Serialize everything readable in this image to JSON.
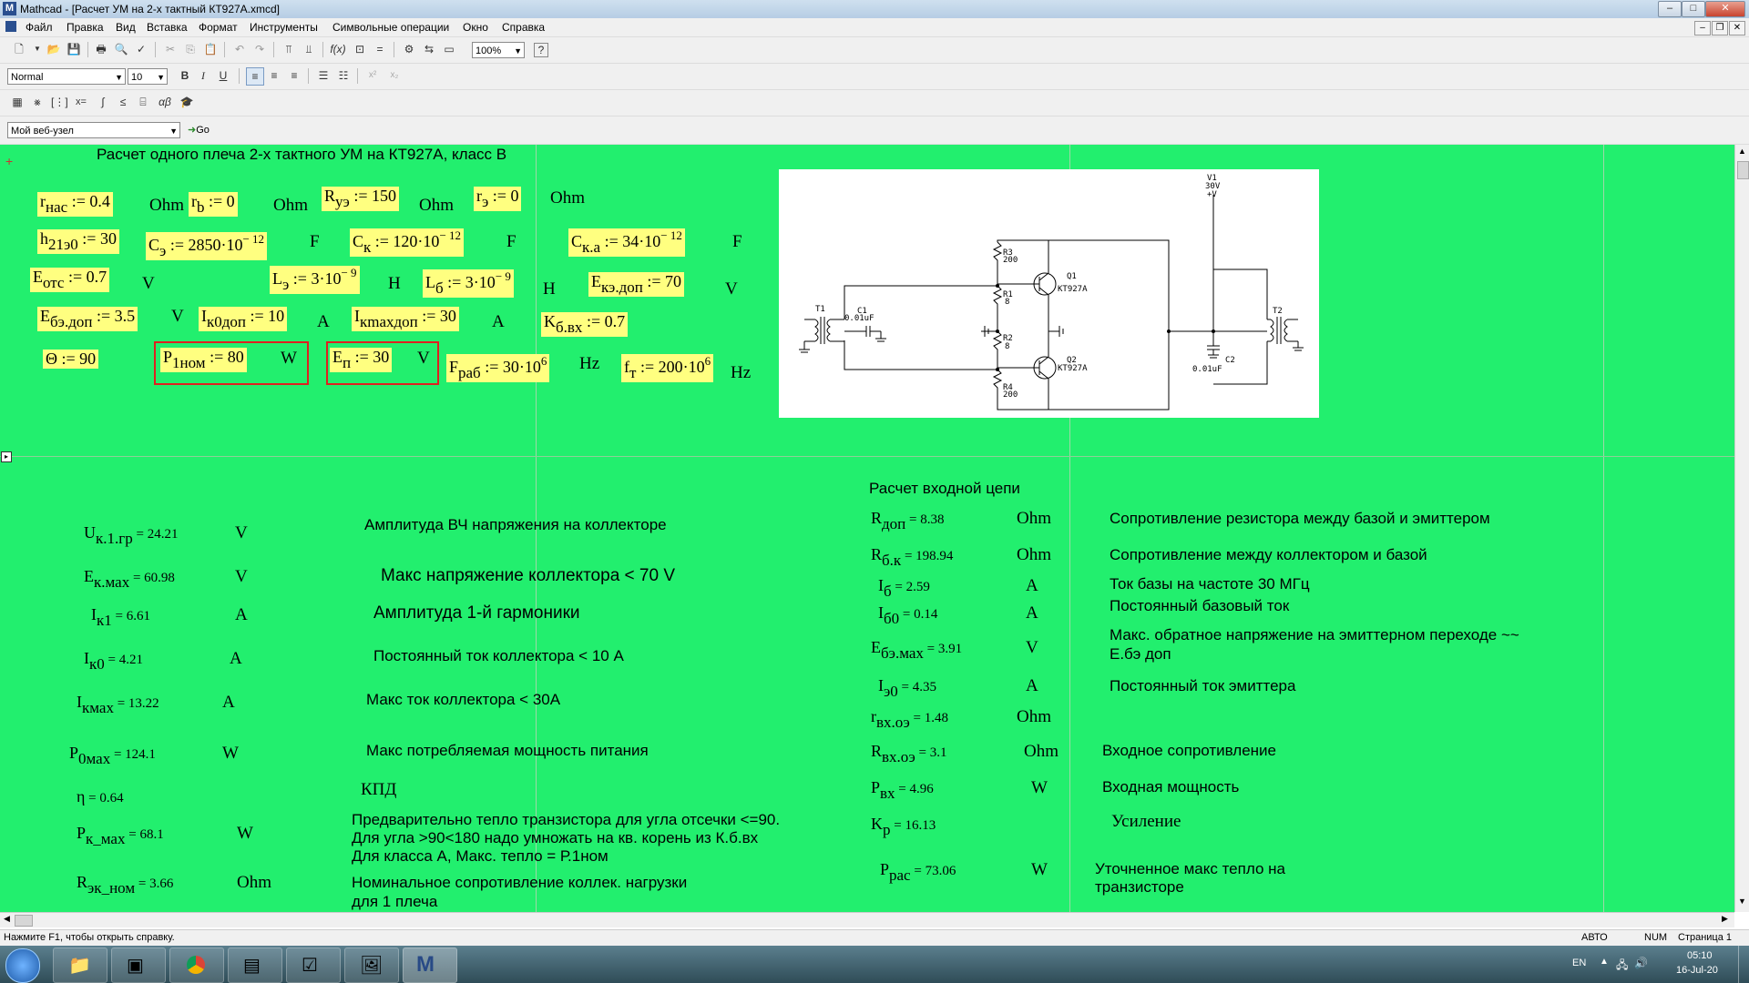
{
  "window": {
    "title": "Mathcad - [Расчет УМ на 2-х тактный КТ927А.xmcd]",
    "app_icon": "M"
  },
  "menu": [
    "Файл",
    "Правка",
    "Вид",
    "Вставка",
    "Формат",
    "Инструменты",
    "Символьные операции",
    "Окно",
    "Справка"
  ],
  "toolbar": {
    "zoom": "100%",
    "style": "Normal",
    "font_size": "10",
    "bold": "B",
    "italic": "I",
    "underline": "U",
    "web_node": "Мой веб-узел",
    "go": "Go"
  },
  "doc": {
    "heading": "Расчет одного плеча 2-х тактного УМ на КТ927А, класс В",
    "params_units": {
      "u1": "Ohm",
      "u2": "Ohm",
      "u3": "Ohm",
      "u4": "Ohm",
      "u5": "F",
      "u6": "F",
      "u7": "F",
      "u8": "V",
      "u9": "H",
      "u10": "H",
      "u11": "V",
      "u12": "V",
      "u13": "A",
      "u14": "A",
      "u15": "W",
      "u16": "V",
      "u17": "Hz",
      "u18": "Hz"
    },
    "results_left": [
      {
        "var": "U",
        "sub": "к.1.гр",
        "val": "24.21",
        "unit": "V",
        "note": "Амплитуда ВЧ напряжения на коллекторе"
      },
      {
        "var": "E",
        "sub": "к.мах",
        "val": "60.98",
        "unit": "V",
        "note": "Макс напряжение коллектора  < 70 V"
      },
      {
        "var": "I",
        "sub": "к1",
        "val": "6.61",
        "unit": "A",
        "note": "Амплитуда 1-й гармоники"
      },
      {
        "var": "I",
        "sub": "к0",
        "val": "4.21",
        "unit": "A",
        "note": "Постоянный ток коллектора < 10 A"
      },
      {
        "var": "I",
        "sub": "кмах",
        "val": "13.22",
        "unit": "A",
        "note": "Макс ток коллектора < 30A"
      },
      {
        "var": "P",
        "sub": "0мах",
        "val": "124.1",
        "unit": "W",
        "note": "Макс потребляемая мощность питания"
      },
      {
        "var": "η",
        "sub": "",
        "val": "0.64",
        "unit": "",
        "note": "КПД"
      },
      {
        "var": "P",
        "sub": "к_мах",
        "val": "68.1",
        "unit": "W",
        "note": ""
      },
      {
        "var": "R",
        "sub": "эк_ном",
        "val": "3.66",
        "unit": "Ohm",
        "note": "Номинальное сопротивление коллек. нагрузки"
      }
    ],
    "note_heat": [
      "Предварительно тепло транзистора для угла отсечки <=90.",
      "Для угла >90<180 надо умножать на кв. корень из К.б.вх",
      "Для класса А, Макс. тепло = Р.1ном"
    ],
    "note_load2": "для 1 плеча",
    "input_title": "Расчет входной цепи",
    "results_right": [
      {
        "var": "R",
        "sub": "доп",
        "val": "8.38",
        "unit": "Ohm",
        "note": "Сопротивление резистора между базой и эмиттером"
      },
      {
        "var": "R",
        "sub": "б.к",
        "val": "198.94",
        "unit": "Ohm",
        "note": "Сопротивление между коллектором и базой"
      },
      {
        "var": "I",
        "sub": "б",
        "val": "2.59",
        "unit": "A",
        "note": "Ток базы на частоте 30 МГц"
      },
      {
        "var": "I",
        "sub": "б0",
        "val": "0.14",
        "unit": "A",
        "note": "Постоянный базовый ток"
      },
      {
        "var": "E",
        "sub": "бэ.мах",
        "val": "3.91",
        "unit": "V",
        "note": "Макс. обратное напряжение на эмиттерном  переходе ~~"
      },
      {
        "var": "I",
        "sub": "э0",
        "val": "4.35",
        "unit": "A",
        "note": "Постоянный ток эмиттера"
      },
      {
        "var": "r",
        "sub": "вх.оэ",
        "val": "1.48",
        "unit": "Ohm",
        "note": ""
      },
      {
        "var": "R",
        "sub": "вх.оэ",
        "val": "3.1",
        "unit": "Ohm",
        "note": "Входное сопротивление"
      },
      {
        "var": "P",
        "sub": "вх",
        "val": "4.96",
        "unit": "W",
        "note": "Входная мощность"
      },
      {
        "var": "K",
        "sub": "р",
        "val": "16.13",
        "unit": "",
        "note": "Усиление"
      },
      {
        "var": "P",
        "sub": "рас",
        "val": "73.06",
        "unit": "W",
        "note": "Уточненное макс тепло на"
      }
    ],
    "note_ebe2": "Е.бэ доп",
    "note_heat2": "транзисторе"
  },
  "circuit": {
    "labels": [
      "V1",
      "30V",
      "+V",
      "R3",
      "200",
      "Q1",
      "KT927A",
      "R1",
      "8",
      "T1",
      "C1",
      "0.01uF",
      "R2",
      "8",
      "Q2",
      "KT927A",
      "R4",
      "200",
      "T2",
      "C2",
      "0.01uF"
    ]
  },
  "status": {
    "help": "Нажмите F1, чтобы открыть справку.",
    "mode": "АВТО",
    "num": "NUM",
    "page": "Страница 1"
  },
  "tray": {
    "lang": "EN",
    "time": "05:10",
    "date": "16-Jul-20"
  }
}
